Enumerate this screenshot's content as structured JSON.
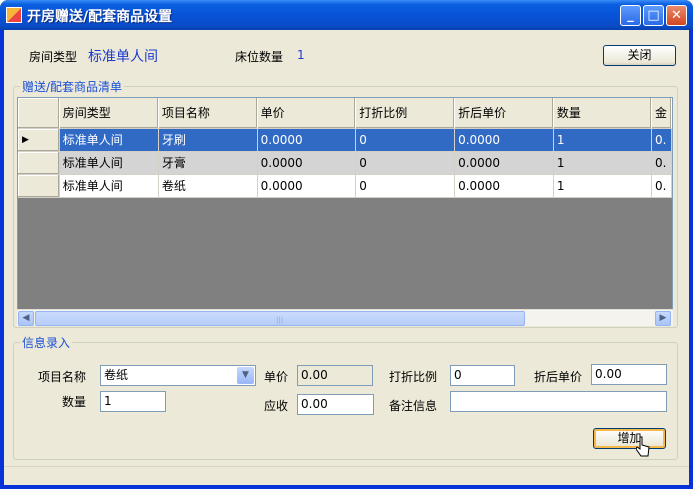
{
  "window": {
    "title": "开房赠送/配套商品设置",
    "controls": [
      "_",
      "□",
      "✕"
    ]
  },
  "header": {
    "room_type_label": "房间类型",
    "room_type_value": "标准单人间",
    "bed_count_label": "床位数量",
    "bed_count_value": "1",
    "close_button": "关闭"
  },
  "list_group": {
    "title": "赠送/配套商品清单",
    "columns": [
      "房间类型",
      "项目名称",
      "单价",
      "打折比例",
      "折后单价",
      "数量",
      "金"
    ],
    "rows": [
      [
        "标准单人间",
        "牙刷",
        "0.0000",
        "0",
        "0.0000",
        "1",
        "0."
      ],
      [
        "标准单人间",
        "牙膏",
        "0.0000",
        "0",
        "0.0000",
        "1",
        "0."
      ],
      [
        "标准单人间",
        "卷纸",
        "0.0000",
        "0",
        "0.0000",
        "1",
        "0."
      ]
    ],
    "current_row_marker": "▶",
    "scroll_grip": "|||"
  },
  "form_group": {
    "title": "信息录入",
    "item_name_label": "项目名称",
    "item_name_value": "卷纸",
    "unit_price_label": "单价",
    "unit_price_value": "0.00",
    "discount_label": "打折比例",
    "discount_value": "0",
    "discounted_price_label": "折后单价",
    "discounted_price_value": "0.00",
    "quantity_label": "数量",
    "quantity_value": "1",
    "receivable_label": "应收",
    "receivable_value": "0.00",
    "remarks_label": "备注信息",
    "remarks_value": "",
    "add_button": "增加"
  }
}
